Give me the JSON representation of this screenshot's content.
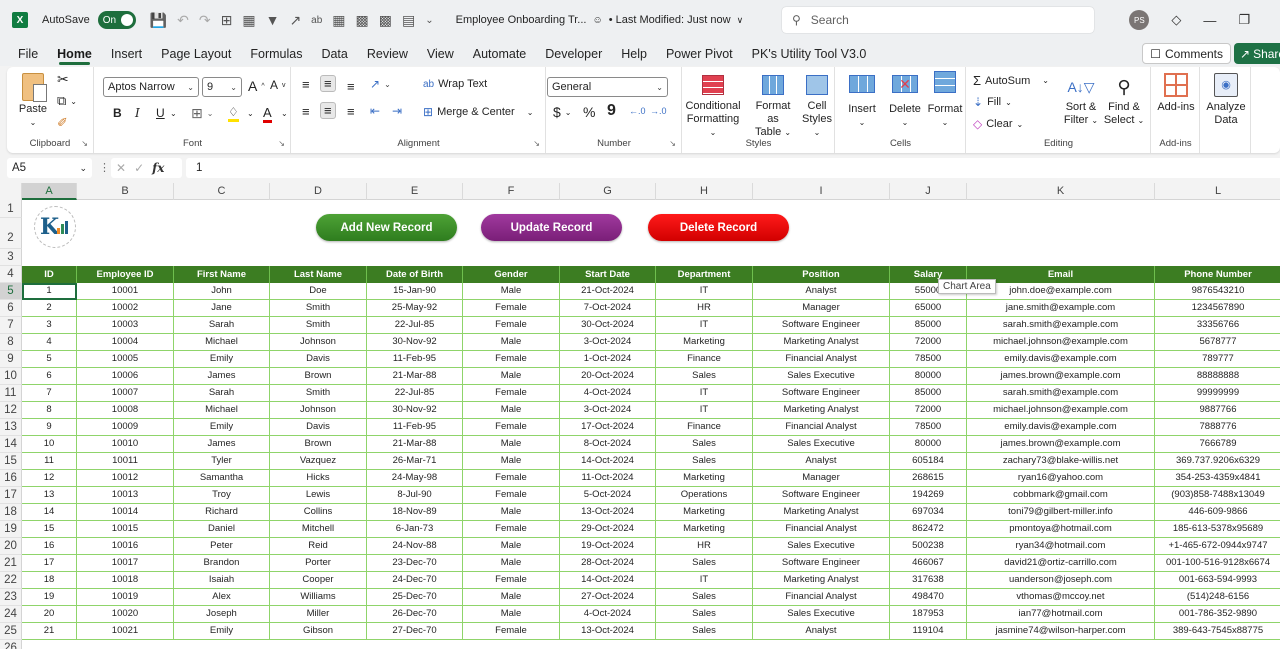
{
  "titlebar": {
    "app_icon": "excel-icon",
    "autosave_label": "AutoSave",
    "autosave_state": "On",
    "doc_title": "Employee Onboarding Tr...",
    "last_modified": "• Last Modified: Just now",
    "search_placeholder": "Search",
    "avatar_initials": "PS"
  },
  "menu": {
    "tabs": [
      "File",
      "Home",
      "Insert",
      "Page Layout",
      "Formulas",
      "Data",
      "Review",
      "View",
      "Automate",
      "Developer",
      "Help",
      "Power Pivot",
      "PK's Utility Tool V3.0"
    ],
    "active": "Home",
    "comments_label": "Comments",
    "share_label": "Share"
  },
  "ribbon": {
    "clipboard": {
      "label": "Clipboard",
      "paste": "Paste"
    },
    "font": {
      "label": "Font",
      "font_name": "Aptos Narrow",
      "font_size": "9",
      "bold": "B",
      "italic": "I",
      "underline": "U"
    },
    "alignment": {
      "label": "Alignment",
      "wrap_text": "Wrap Text",
      "merge_center": "Merge & Center"
    },
    "number": {
      "label": "Number",
      "format": "General",
      "currency": "$",
      "percent": "%",
      "comma": "9"
    },
    "styles": {
      "label": "Styles",
      "conditional_1": "Conditional",
      "conditional_2": "Formatting",
      "format_table_1": "Format as",
      "format_table_2": "Table",
      "cell_styles_1": "Cell",
      "cell_styles_2": "Styles"
    },
    "cells": {
      "label": "Cells",
      "insert": "Insert",
      "delete": "Delete",
      "format": "Format"
    },
    "editing": {
      "label": "Editing",
      "autosum": "AutoSum",
      "fill": "Fill",
      "clear": "Clear",
      "sort_1": "Sort &",
      "sort_2": "Filter",
      "find_1": "Find &",
      "find_2": "Select"
    },
    "addins": {
      "label": "Add-ins",
      "addins_btn": "Add-ins"
    },
    "analyze": {
      "label_1": "Analyze",
      "label_2": "Data"
    }
  },
  "formula_bar": {
    "name_box": "A5",
    "formula": "1"
  },
  "sheet": {
    "columns": [
      "A",
      "B",
      "C",
      "D",
      "E",
      "F",
      "G",
      "H",
      "I",
      "J",
      "K",
      "L"
    ],
    "row_numbers": [
      "1",
      "2",
      "3",
      "4",
      "5",
      "6",
      "7",
      "8",
      "9",
      "10",
      "11",
      "12",
      "13",
      "14",
      "15",
      "16",
      "17",
      "18",
      "19",
      "20",
      "21",
      "22",
      "23",
      "24",
      "25",
      "26"
    ],
    "buttons": {
      "add": "Add New Record",
      "update": "Update Record",
      "delete": "Delete Record"
    },
    "tooltip": "Chart Area",
    "headers": [
      "ID",
      "Employee ID",
      "First Name",
      "Last Name",
      "Date of Birth",
      "Gender",
      "Start Date",
      "Department",
      "Position",
      "Salary",
      "Email",
      "Phone Number"
    ],
    "rows": [
      [
        "1",
        "10001",
        "John",
        "Doe",
        "15-Jan-90",
        "Male",
        "21-Oct-2024",
        "IT",
        "Analyst",
        "55000",
        "john.doe@example.com",
        "9876543210"
      ],
      [
        "2",
        "10002",
        "Jane",
        "Smith",
        "25-May-92",
        "Female",
        "7-Oct-2024",
        "HR",
        "Manager",
        "65000",
        "jane.smith@example.com",
        "1234567890"
      ],
      [
        "3",
        "10003",
        "Sarah",
        "Smith",
        "22-Jul-85",
        "Female",
        "30-Oct-2024",
        "IT",
        "Software Engineer",
        "85000",
        "sarah.smith@example.com",
        "33356766"
      ],
      [
        "4",
        "10004",
        "Michael",
        "Johnson",
        "30-Nov-92",
        "Male",
        "3-Oct-2024",
        "Marketing",
        "Marketing Analyst",
        "72000",
        "michael.johnson@example.com",
        "5678777"
      ],
      [
        "5",
        "10005",
        "Emily",
        "Davis",
        "11-Feb-95",
        "Female",
        "1-Oct-2024",
        "Finance",
        "Financial Analyst",
        "78500",
        "emily.davis@example.com",
        "789777"
      ],
      [
        "6",
        "10006",
        "James",
        "Brown",
        "21-Mar-88",
        "Male",
        "20-Oct-2024",
        "Sales",
        "Sales Executive",
        "80000",
        "james.brown@example.com",
        "88888888"
      ],
      [
        "7",
        "10007",
        "Sarah",
        "Smith",
        "22-Jul-85",
        "Female",
        "4-Oct-2024",
        "IT",
        "Software Engineer",
        "85000",
        "sarah.smith@example.com",
        "99999999"
      ],
      [
        "8",
        "10008",
        "Michael",
        "Johnson",
        "30-Nov-92",
        "Male",
        "3-Oct-2024",
        "IT",
        "Marketing Analyst",
        "72000",
        "michael.johnson@example.com",
        "9887766"
      ],
      [
        "9",
        "10009",
        "Emily",
        "Davis",
        "11-Feb-95",
        "Female",
        "17-Oct-2024",
        "Finance",
        "Financial Analyst",
        "78500",
        "emily.davis@example.com",
        "7888776"
      ],
      [
        "10",
        "10010",
        "James",
        "Brown",
        "21-Mar-88",
        "Male",
        "8-Oct-2024",
        "Sales",
        "Sales Executive",
        "80000",
        "james.brown@example.com",
        "7666789"
      ],
      [
        "11",
        "10011",
        "Tyler",
        "Vazquez",
        "26-Mar-71",
        "Male",
        "14-Oct-2024",
        "Sales",
        "Analyst",
        "605184",
        "zachary73@blake-willis.net",
        "369.737.9206x6329"
      ],
      [
        "12",
        "10012",
        "Samantha",
        "Hicks",
        "24-May-98",
        "Female",
        "11-Oct-2024",
        "Marketing",
        "Manager",
        "268615",
        "ryan16@yahoo.com",
        "354-253-4359x4841"
      ],
      [
        "13",
        "10013",
        "Troy",
        "Lewis",
        "8-Jul-90",
        "Female",
        "5-Oct-2024",
        "Operations",
        "Software Engineer",
        "194269",
        "cobbmark@gmail.com",
        "(903)858-7488x13049"
      ],
      [
        "14",
        "10014",
        "Richard",
        "Collins",
        "18-Nov-89",
        "Male",
        "13-Oct-2024",
        "Marketing",
        "Marketing Analyst",
        "697034",
        "toni79@gilbert-miller.info",
        "446-609-9866"
      ],
      [
        "15",
        "10015",
        "Daniel",
        "Mitchell",
        "6-Jan-73",
        "Female",
        "29-Oct-2024",
        "Marketing",
        "Financial Analyst",
        "862472",
        "pmontoya@hotmail.com",
        "185-613-5378x95689"
      ],
      [
        "16",
        "10016",
        "Peter",
        "Reid",
        "24-Nov-88",
        "Male",
        "19-Oct-2024",
        "HR",
        "Sales Executive",
        "500238",
        "ryan34@hotmail.com",
        "+1-465-672-0944x9747"
      ],
      [
        "17",
        "10017",
        "Brandon",
        "Porter",
        "23-Dec-70",
        "Male",
        "28-Oct-2024",
        "Sales",
        "Software Engineer",
        "466067",
        "david21@ortiz-carrillo.com",
        "001-100-516-9128x6674"
      ],
      [
        "18",
        "10018",
        "Isaiah",
        "Cooper",
        "24-Dec-70",
        "Female",
        "14-Oct-2024",
        "IT",
        "Marketing Analyst",
        "317638",
        "uanderson@joseph.com",
        "001-663-594-9993"
      ],
      [
        "19",
        "10019",
        "Alex",
        "Williams",
        "25-Dec-70",
        "Male",
        "27-Oct-2024",
        "Sales",
        "Financial Analyst",
        "498470",
        "vthomas@mccoy.net",
        "(514)248-6156"
      ],
      [
        "20",
        "10020",
        "Joseph",
        "Miller",
        "26-Dec-70",
        "Male",
        "4-Oct-2024",
        "Sales",
        "Sales Executive",
        "187953",
        "ian77@hotmail.com",
        "001-786-352-9890"
      ],
      [
        "21",
        "10021",
        "Emily",
        "Gibson",
        "27-Dec-70",
        "Female",
        "13-Oct-2024",
        "Sales",
        "Analyst",
        "119104",
        "jasmine74@wilson-harper.com",
        "389-643-7545x88775"
      ]
    ]
  }
}
